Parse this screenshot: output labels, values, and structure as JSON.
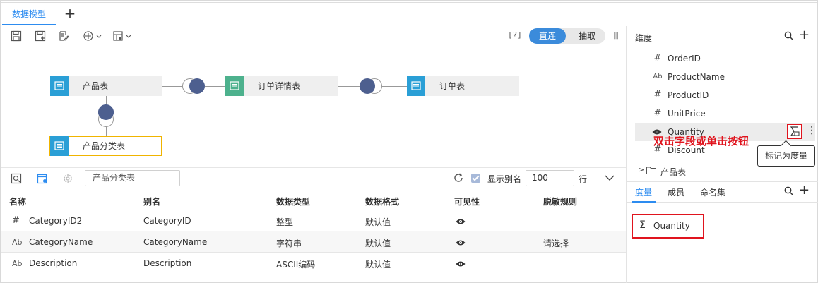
{
  "tabs": {
    "active": "数据模型",
    "add": "+"
  },
  "toolbar": {
    "help": "[?]",
    "mode_direct": "直连",
    "mode_extract": "抽取",
    "more": "|||"
  },
  "canvas": {
    "tables": [
      {
        "name": "产品表",
        "color": "#2a9fd6"
      },
      {
        "name": "订单详情表",
        "color": "#4db18d"
      },
      {
        "name": "订单表",
        "color": "#2a9fd6"
      },
      {
        "name": "产品分类表",
        "color": "#2a9fd6"
      }
    ]
  },
  "fields_panel": {
    "search_value": "产品分类表",
    "show_alias_label": "显示别名",
    "row_count": "100",
    "row_unit": "行",
    "columns": [
      "名称",
      "别名",
      "数据类型",
      "数据格式",
      "可见性",
      "脱敏规则"
    ],
    "rows": [
      {
        "type_icon": "#",
        "name": "CategoryID2",
        "alias": "CategoryID",
        "dtype": "整型",
        "format": "默认值",
        "mask": ""
      },
      {
        "type_icon": "Ab",
        "name": "CategoryName",
        "alias": "CategoryName",
        "dtype": "字符串",
        "format": "默认值",
        "mask": "请选择"
      },
      {
        "type_icon": "Ab",
        "name": "Description",
        "alias": "Description",
        "dtype": "ASCII编码",
        "format": "默认值",
        "mask": ""
      }
    ]
  },
  "right_panel": {
    "dimension_title": "维度",
    "add": "+",
    "dimensions": [
      {
        "icon": "#",
        "name": "OrderID"
      },
      {
        "icon": "Ab",
        "name": "ProductName"
      },
      {
        "icon": "#",
        "name": "ProductID"
      },
      {
        "icon": "#",
        "name": "UnitPrice"
      },
      {
        "icon": "eye",
        "name": "Quantity"
      },
      {
        "icon": "#",
        "name": "Discount"
      }
    ],
    "folder": "产品表",
    "annotation": "双击字段或单击按钮",
    "tooltip": "标记为度量",
    "kebab": "⋮",
    "measure_tabs": [
      "度量",
      "成员",
      "命名集"
    ],
    "measures": [
      {
        "symbol": "Σ",
        "name": "Quantity"
      }
    ]
  },
  "colors": {
    "accent": "#2d8cf0",
    "highlight": "#e0141e",
    "join": "#4d5f8f",
    "selected_border": "#f0b400"
  }
}
